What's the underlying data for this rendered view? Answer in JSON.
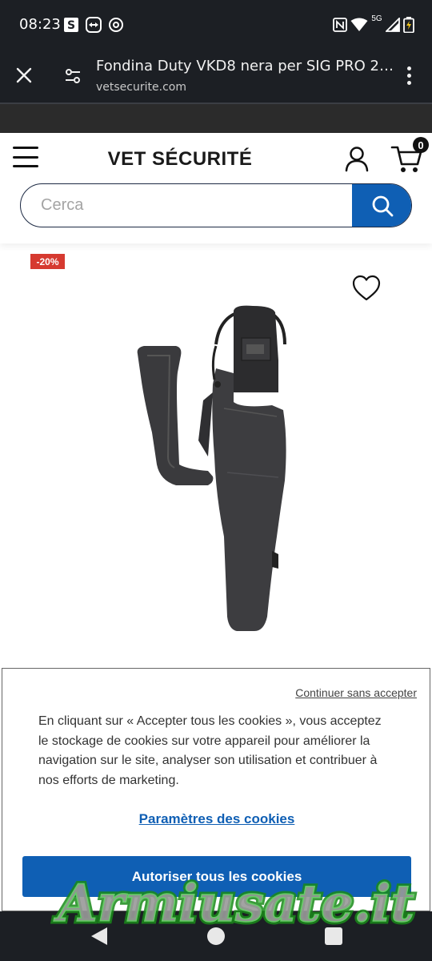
{
  "status_bar": {
    "time": "08:23",
    "network": "5G",
    "icons": [
      "s-app-icon",
      "teamviewer-icon",
      "at-sign-icon",
      "nfc-icon",
      "wifi-icon",
      "signal-icon",
      "battery-charging-icon"
    ]
  },
  "browser": {
    "page_title": "Fondina Duty VKD8 nera per SIG PRO 2022 ...",
    "url": "vetsecurite.com",
    "icons": [
      "close-icon",
      "site-settings-icon",
      "more-vert-icon"
    ]
  },
  "header": {
    "logo": "VET SÉCURITÉ",
    "cart_count": "0",
    "search": {
      "placeholder": "Cerca"
    },
    "icons": [
      "menu-icon",
      "account-icon",
      "cart-icon",
      "search-icon"
    ]
  },
  "product": {
    "discount": "-20%",
    "icons": [
      "heart-icon"
    ]
  },
  "cookie_banner": {
    "continue_without": "Continuer sans accepter",
    "text": "En cliquant sur « Accepter tous les cookies », vous acceptez le stockage de cookies sur votre appareil pour améliorer la navigation sur le site, analyser son utilisation et contribuer à nos efforts de marketing.",
    "settings": "Paramètres des cookies",
    "accept_all": "Autoriser tous les cookies"
  },
  "watermark": {
    "text": "Armiusate.it"
  },
  "colors": {
    "accent": "#0f5fb4",
    "discount": "#d63a30",
    "system_bar": "#1c1f24"
  }
}
